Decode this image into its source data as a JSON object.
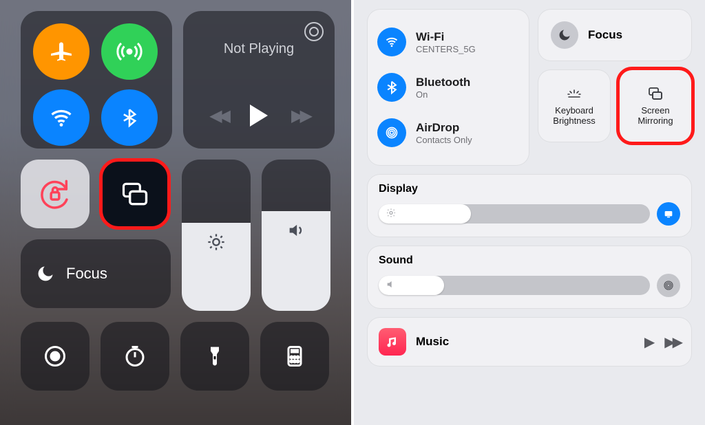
{
  "left": {
    "connectivity": {
      "airplane": "airplane",
      "cellular": "cellular",
      "wifi": "wifi",
      "bluetooth": "bluetooth"
    },
    "music": {
      "status": "Not Playing"
    },
    "focus_label": "Focus",
    "highlight": "screen-mirroring"
  },
  "right": {
    "network": {
      "wifi": {
        "title": "Wi-Fi",
        "subtitle": "CENTERS_5G"
      },
      "bluetooth": {
        "title": "Bluetooth",
        "subtitle": "On"
      },
      "airdrop": {
        "title": "AirDrop",
        "subtitle": "Contacts Only"
      }
    },
    "focus_label": "Focus",
    "keyboard_brightness_label": "Keyboard Brightness",
    "screen_mirroring_label": "Screen Mirroring",
    "display": {
      "label": "Display",
      "value_pct": 34
    },
    "sound": {
      "label": "Sound",
      "value_pct": 24
    },
    "music": {
      "label": "Music"
    }
  }
}
